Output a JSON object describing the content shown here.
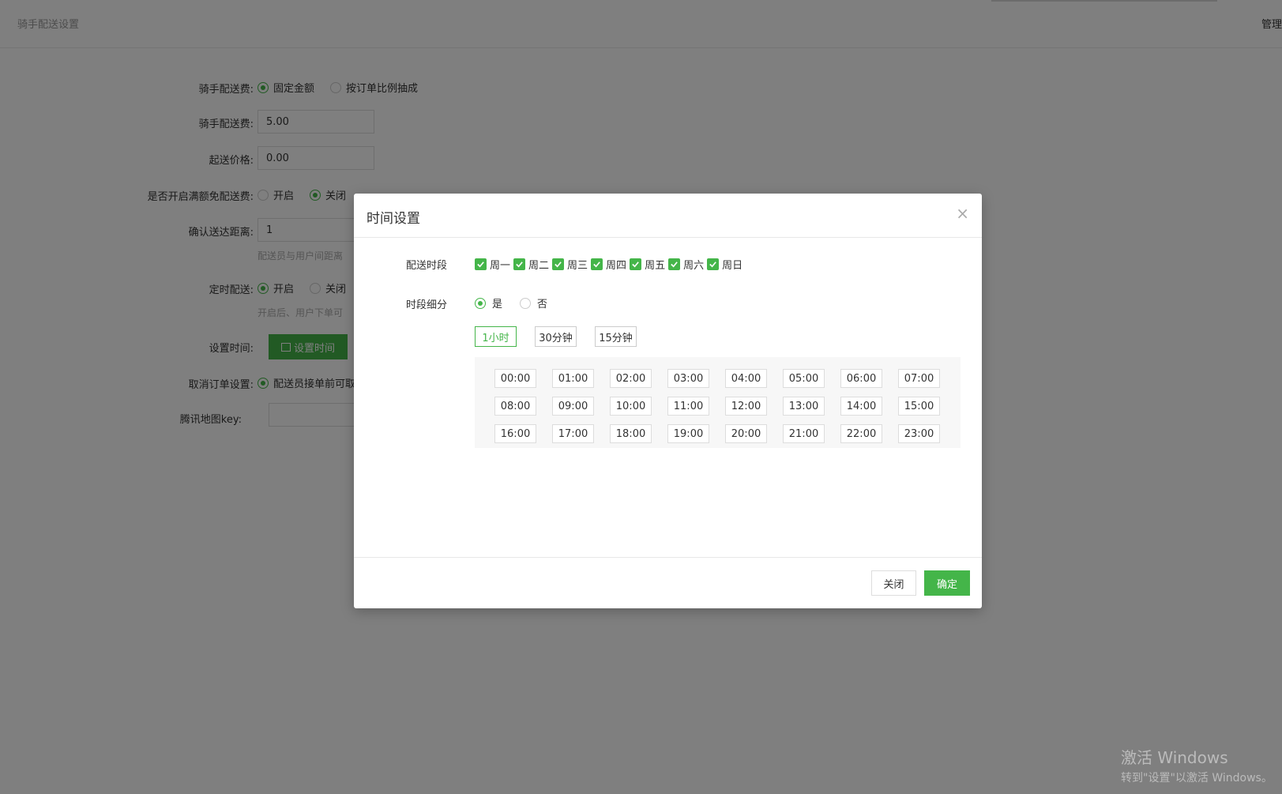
{
  "topbar": {
    "title": "骑手配送设置",
    "manage": "管理"
  },
  "form": {
    "fee_mode_label": "骑手配送费:",
    "fee_mode_options": [
      "固定金额",
      "按订单比例抽成"
    ],
    "fee_label": "骑手配送费:",
    "fee_value": "5.00",
    "min_price_label": "起送价格:",
    "min_price_value": "0.00",
    "free_delivery_label": "是否开启满额免配送费:",
    "free_delivery_options": [
      "开启",
      "关闭"
    ],
    "distance_label": "确认送达距离:",
    "distance_value": "1",
    "distance_hint": "配送员与用户间距离",
    "scheduled_label": "定时配送:",
    "scheduled_options": [
      "开启",
      "关闭"
    ],
    "scheduled_hint": "开启后、用户下单可",
    "set_time_label": "设置时间:",
    "set_time_button": "设置时间",
    "cancel_label": "取消订单设置:",
    "cancel_option": "配送员接单前可取",
    "map_key_label": "腾讯地图key:"
  },
  "modal": {
    "title": "时间设置",
    "close_symbol": "×",
    "days_label": "配送时段",
    "days": [
      "周一",
      "周二",
      "周三",
      "周四",
      "周五",
      "周六",
      "周日"
    ],
    "split_label": "时段细分",
    "split_options": [
      "是",
      "否"
    ],
    "intervals": [
      "1小时",
      "30分钟",
      "15分钟"
    ],
    "slots": [
      [
        "00:00",
        "01:00",
        "02:00",
        "03:00",
        "04:00",
        "05:00",
        "06:00",
        "07:00"
      ],
      [
        "08:00",
        "09:00",
        "10:00",
        "11:00",
        "12:00",
        "13:00",
        "14:00",
        "15:00"
      ],
      [
        "16:00",
        "17:00",
        "18:00",
        "19:00",
        "20:00",
        "21:00",
        "22:00",
        "23:00"
      ]
    ],
    "close_button": "关闭",
    "confirm_button": "确定"
  },
  "watermark": {
    "line1": "激活 Windows",
    "line2": "转到\"设置\"以激活 Windows。"
  },
  "colors": {
    "accent": "#44b549",
    "overlay": "rgba(0,0,0,0.5)"
  }
}
